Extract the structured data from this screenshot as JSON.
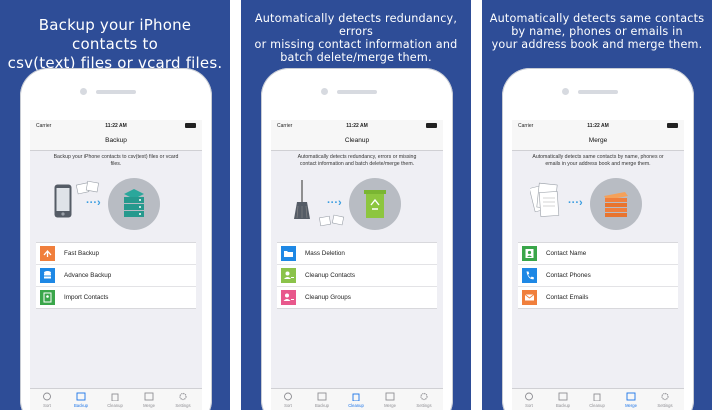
{
  "colors": {
    "panel_bg": "#2e4d97",
    "accent": "#1a73e8",
    "arrow": "#3a9de0",
    "icon_orange": "#f07f3c",
    "icon_blue": "#1e88e5",
    "icon_green": "#3aa64a",
    "icon_pink": "#e8588c",
    "icon_lightgreen": "#8bc34a",
    "recycle_green": "#8dc63f"
  },
  "status": {
    "carrier": "Carrier",
    "time": "11:22 AM"
  },
  "tabs": [
    "Sort",
    "Backup",
    "Cleanup",
    "Merge",
    "Settings"
  ],
  "panels": [
    {
      "caption": [
        "Backup your iPhone contacts to",
        "csv(text) files or vcard files."
      ],
      "title": "Backup",
      "description": [
        "Backup your iPhone contacts to csv(text) files or vcard",
        "files."
      ],
      "illustration": [
        "phone-icon",
        "file-icons",
        "arrow-icon",
        "server-icon"
      ],
      "items": [
        {
          "label": "Fast Backup",
          "icon": "backup-icon",
          "color": "#f07f3c"
        },
        {
          "label": "Advance Backup",
          "icon": "database-icon",
          "color": "#1e88e5"
        },
        {
          "label": "Import Contacts",
          "icon": "import-icon",
          "color": "#3aa64a"
        }
      ],
      "active_tab": 1
    },
    {
      "caption": [
        "Automatically detects redundancy, errors",
        "or missing contact information and",
        "batch delete/merge them."
      ],
      "title": "Cleanup",
      "description": [
        "Automatically detects redundancy, errors or missing",
        "contact information and batch delete/merge them."
      ],
      "illustration": [
        "broom-icon",
        "file-icons",
        "arrow-icon",
        "recycle-bin-icon"
      ],
      "items": [
        {
          "label": "Mass Deletion",
          "icon": "folder-icon",
          "color": "#1e88e5"
        },
        {
          "label": "Cleanup Contacts",
          "icon": "contact-clean-icon",
          "color": "#8bc34a"
        },
        {
          "label": "Cleanup Groups",
          "icon": "group-icon",
          "color": "#e8588c"
        }
      ],
      "active_tab": 2
    },
    {
      "caption": [
        "Automatically detects same contacts",
        "by name, phones or emails in",
        "your address book and merge them."
      ],
      "title": "Merge",
      "description": [
        "Automatically detects same contacts by name, phones or",
        "emails in your address book and merge them."
      ],
      "illustration": [
        "documents-icon",
        "arrow-icon",
        "stack-icon"
      ],
      "items": [
        {
          "label": "Contact Name",
          "icon": "person-icon",
          "color": "#3aa64a"
        },
        {
          "label": "Contact Phones",
          "icon": "phone-handset-icon",
          "color": "#1e88e5"
        },
        {
          "label": "Contact Emails",
          "icon": "email-icon",
          "color": "#f07f3c"
        }
      ],
      "active_tab": 3
    }
  ]
}
